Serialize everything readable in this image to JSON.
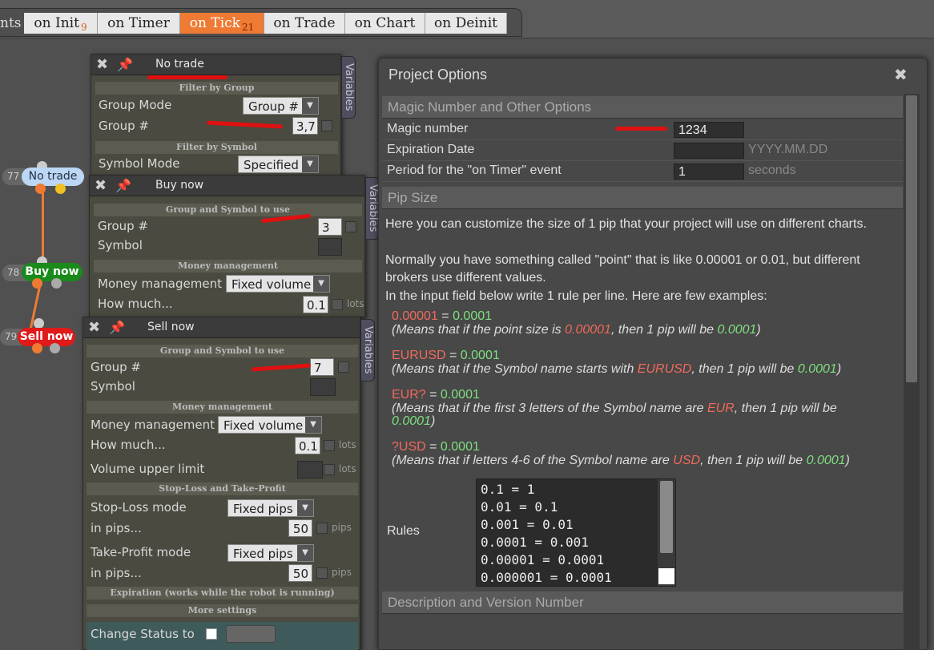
{
  "tabs": {
    "cut_label": "nts",
    "items": [
      {
        "label": "on Init",
        "count": "9"
      },
      {
        "label": "on Timer",
        "count": ""
      },
      {
        "label": "on Tick",
        "count": "21"
      },
      {
        "label": "on Trade",
        "count": ""
      },
      {
        "label": "on Chart",
        "count": ""
      },
      {
        "label": "on Deinit",
        "count": ""
      }
    ],
    "active": "on Tick"
  },
  "nodes": [
    {
      "num": "77",
      "label": "No trade",
      "color": "#bcd6f5"
    },
    {
      "num": "78",
      "label": "Buy now",
      "color": "#1a8a1a"
    },
    {
      "num": "79",
      "label": "Sell now",
      "color": "#e01a1a"
    }
  ],
  "panel_notrade": {
    "title": "No trade",
    "variables_tab": "Variables",
    "filter_group": "Filter by Group",
    "group_mode_label": "Group Mode",
    "group_mode_value": "Group #",
    "group_label": "Group #",
    "group_value": "3,7",
    "filter_symbol": "Filter by Symbol",
    "symbol_mode_label": "Symbol Mode",
    "symbol_mode_value": "Specified"
  },
  "panel_buy": {
    "title": "Buy now",
    "variables_tab": "Variables",
    "sec_group": "Group and Symbol to use",
    "group_label": "Group #",
    "group_value": "3",
    "symbol_label": "Symbol",
    "sec_money": "Money management",
    "mm_label": "Money management",
    "mm_value": "Fixed volume",
    "how_label": "How much...",
    "how_value": "0.1",
    "unit": "lots"
  },
  "panel_sell": {
    "title": "Sell now",
    "variables_tab": "Variables",
    "sec_group": "Group and Symbol to use",
    "group_label": "Group #",
    "group_value": "7",
    "symbol_label": "Symbol",
    "sec_money": "Money management",
    "mm_label": "Money management",
    "mm_value": "Fixed volume",
    "how_label": "How much...",
    "how_value": "0.1",
    "unit": "lots",
    "vol_label": "Volume upper limit",
    "sec_sltp": "Stop-Loss and Take-Profit",
    "sl_label": "Stop-Loss mode",
    "sl_value": "Fixed pips",
    "sl_pips_label": "in pips...",
    "sl_pips_value": "50",
    "tp_label": "Take-Profit mode",
    "tp_value": "Fixed pips",
    "tp_pips_label": "in pips...",
    "tp_pips_value": "50",
    "pips_unit": "pips",
    "sec_expiration": "Expiration (works while the robot is running)",
    "sec_more": "More settings",
    "change_status": "Change Status to"
  },
  "project_options": {
    "title": "Project Options",
    "sec_magic": "Magic Number and Other Options",
    "magic_label": "Magic number",
    "magic_value": "1234",
    "exp_label": "Expiration Date",
    "exp_placeholder": "YYYY.MM.DD",
    "timer_label": "Period for the \"on Timer\" event",
    "timer_value": "1",
    "timer_unit": "seconds",
    "sec_pip": "Pip Size",
    "para1": "Here you can customize the size of 1 pip that your project will use on different charts.",
    "para2": "Normally you have something called \"point\" that is like 0.00001 or 0.01, but different brokers use different values.",
    "para3": "In the input field below write 1 rule per line. Here are few examples:",
    "ex1_key": "0.00001",
    "ex1_val": "0.0001",
    "ex1_a": "(Means that if the point size is ",
    "ex1_b": "0.00001",
    "ex1_c": ", then 1 pip will be ",
    "ex1_d": "0.0001",
    "ex1_e": ")",
    "ex2_key": "EURUSD",
    "ex2_val": "0.0001",
    "ex2_a": "(Means that if the Symbol name starts with ",
    "ex2_b": "EURUSD",
    "ex2_c": ", then 1 pip will be ",
    "ex2_d": "0.0001",
    "ex2_e": ")",
    "ex3_key": "EUR?",
    "ex3_val": "0.0001",
    "ex3_a": "(Means that if the first 3 letters of the Symbol name are ",
    "ex3_b": "EUR",
    "ex3_c": ", then 1 pip will be ",
    "ex3_d": "0.0001",
    "ex3_e": ")",
    "ex4_key": "?USD",
    "ex4_val": "0.0001",
    "ex4_a": "(Means that if letters 4-6 of the Symbol name are ",
    "ex4_b": "USD",
    "ex4_c": ", then 1 pip will be ",
    "ex4_d": "0.0001",
    "ex4_e": ")",
    "eq": " = ",
    "rules_label": "Rules",
    "rules": [
      "0.1 = 1",
      "0.01 = 0.1",
      "0.001 = 0.01",
      "0.0001 = 0.001",
      "0.00001 = 0.0001",
      "0.000001 = 0.0001"
    ],
    "sec_desc": "Description and Version Number"
  }
}
